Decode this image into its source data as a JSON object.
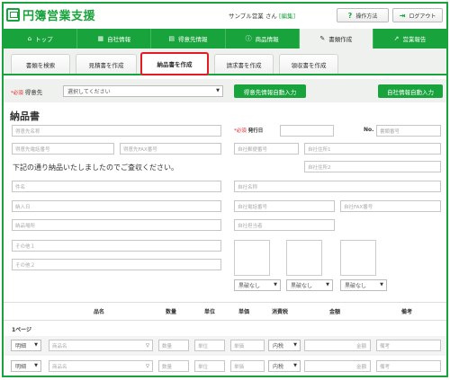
{
  "app": {
    "name": "円簿営業支援"
  },
  "header": {
    "user_name": "サンプル営業",
    "honorific": "さん",
    "edit_link": "[編集]",
    "help_label": "操作方法",
    "logout_label": "ログアウト"
  },
  "nav": {
    "items": [
      {
        "label": "トップ",
        "icon": "home-icon"
      },
      {
        "label": "自社情報",
        "icon": "building-icon"
      },
      {
        "label": "得意先情報",
        "icon": "contacts-icon"
      },
      {
        "label": "商品情報",
        "icon": "info-icon"
      },
      {
        "label": "書類作成",
        "icon": "edit-icon"
      },
      {
        "label": "営業報告",
        "icon": "chart-icon"
      }
    ]
  },
  "tabs": [
    "書類を検索",
    "見積書を作成",
    "納品書を作成",
    "請求書を作成",
    "領収書を作成"
  ],
  "client": {
    "required": "*必須",
    "label": "得意先",
    "select_value": "選択してください",
    "btn_client_autofill": "得意先情報自動入力",
    "btn_company_autofill": "自社情報自動入力"
  },
  "document": {
    "title": "納品書",
    "client_name_placeholder": "得意先名称",
    "issue_required": "*必須",
    "issue_label": "発行日",
    "no_label": "No.",
    "doc_no_placeholder": "書類番号",
    "client_phone_placeholder": "得意先電話番号",
    "client_fax_placeholder": "得意先FAX番号",
    "company_zip_placeholder": "自社郵便番号",
    "company_addr1_placeholder": "自社住所1",
    "company_addr2_placeholder": "自社住所2",
    "message": "下記の通り納品いたしましたのでご査収ください。",
    "subject_placeholder": "件名",
    "company_name_placeholder": "自社名称",
    "delivery_date_placeholder": "納入日",
    "company_phone_placeholder": "自社電話番号",
    "company_fax_placeholder": "自社FAX番号",
    "delivery_place_placeholder": "納品場所",
    "company_rep_placeholder": "自社担当者",
    "other1_placeholder": "その他１",
    "other2_placeholder": "その他２",
    "seal_options": [
      "黒破なし",
      "黒破なし",
      "黒破なし"
    ]
  },
  "table": {
    "headers": [
      "品名",
      "数量",
      "単位",
      "単価",
      "消費税",
      "金額",
      "備考"
    ],
    "page_label": "1ページ",
    "rows": [
      {
        "type": "明細",
        "item": "商品名",
        "qty": "数量",
        "unit": "単位",
        "price": "単価",
        "tax": "内税",
        "amount": "金額",
        "note": "備考"
      },
      {
        "type": "明細",
        "item": "商品名",
        "qty": "数量",
        "unit": "単位",
        "price": "単価",
        "tax": "内税",
        "amount": "金額",
        "note": "備考"
      }
    ]
  },
  "colors": {
    "brand_green": "#19a33c",
    "highlight_red": "#e31b23",
    "panel_gray": "#eef1ee"
  }
}
